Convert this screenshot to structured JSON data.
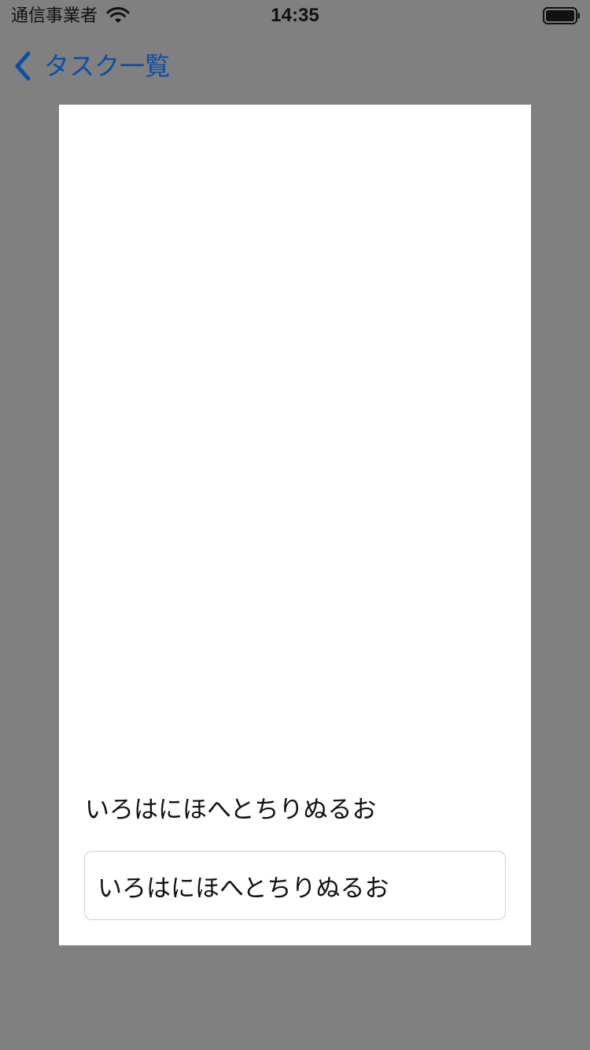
{
  "status_bar": {
    "carrier": "通信事業者",
    "time": "14:35",
    "wifi_icon": "wifi-icon",
    "battery_icon": "battery-icon"
  },
  "nav": {
    "back_label": "タスク一覧",
    "back_icon": "chevron-left-icon",
    "tint_color": "#0b4fa6"
  },
  "content": {
    "label_text": "いろはにほへとちりぬるお",
    "input_value": "いろはにほへとちりぬるお"
  },
  "colors": {
    "dimmed_background": "#808080",
    "card_background": "#ffffff"
  }
}
